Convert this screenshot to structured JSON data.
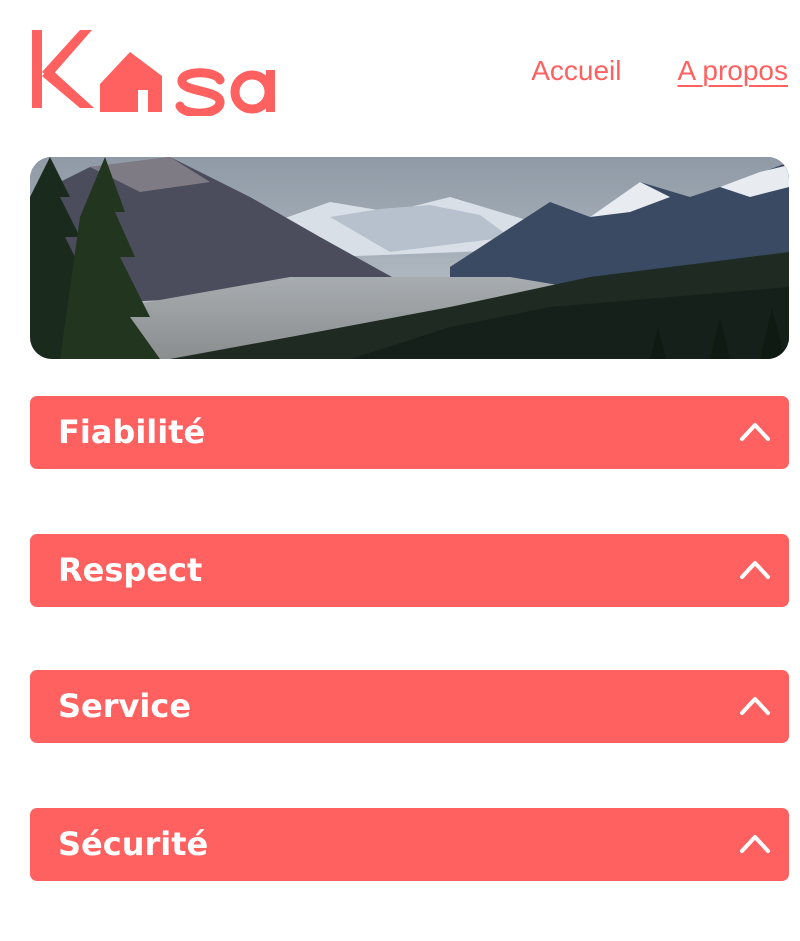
{
  "header": {
    "logo_text": "Kasa",
    "nav": [
      {
        "label": "Accueil",
        "active": false
      },
      {
        "label": "A propos",
        "active": true
      }
    ]
  },
  "banner": {
    "image": "mountain-landscape-banner"
  },
  "collapses": [
    {
      "title": "Fiabilité",
      "icon": "chevron-up-icon"
    },
    {
      "title": "Respect",
      "icon": "chevron-up-icon"
    },
    {
      "title": "Service",
      "icon": "chevron-up-icon"
    },
    {
      "title": "Sécurité",
      "icon": "chevron-up-icon"
    }
  ],
  "colors": {
    "accent": "#FF6060",
    "text_on_accent": "#FFFFFF"
  }
}
